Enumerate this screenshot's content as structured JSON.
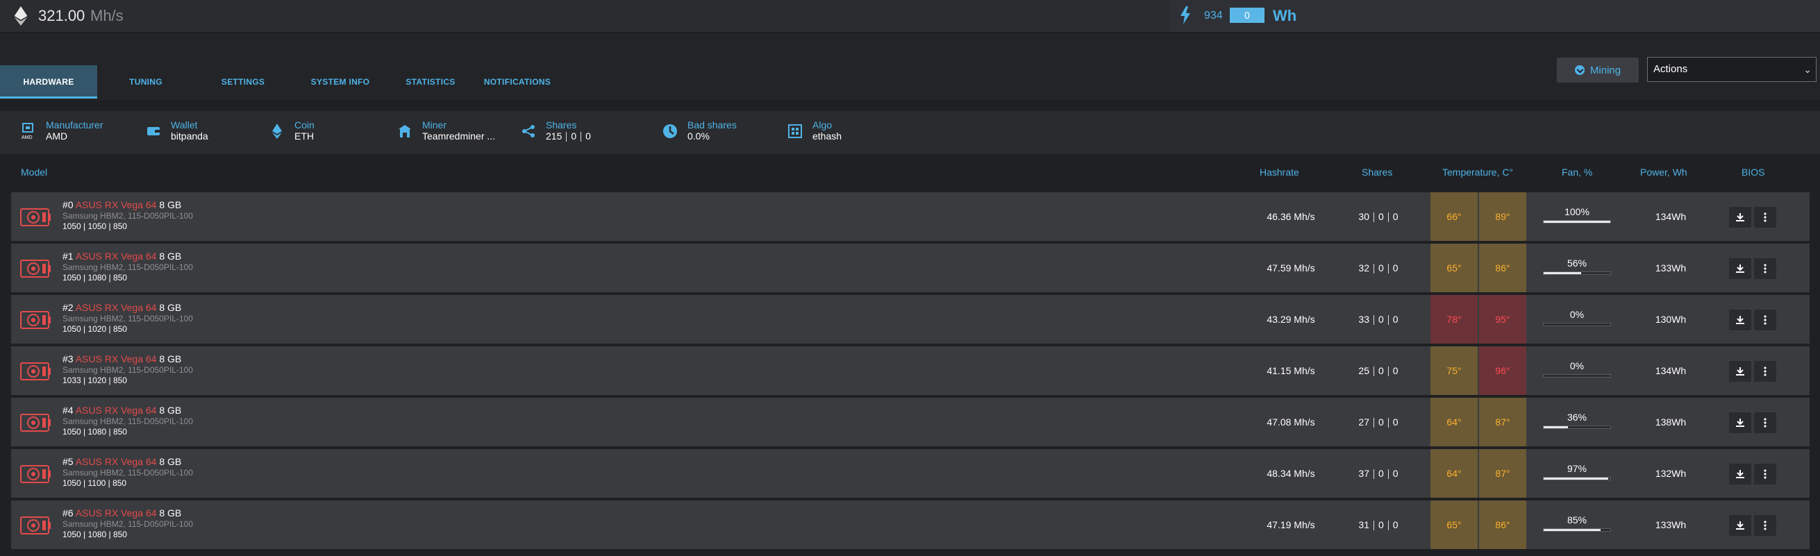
{
  "topbar": {
    "hashrate_value": "321.00",
    "hashrate_unit": "Mh/s",
    "power_value": "934",
    "power_box": "0",
    "power_unit": "Wh"
  },
  "tabs": [
    {
      "label": "HARDWARE",
      "active": true
    },
    {
      "label": "TUNING"
    },
    {
      "label": "SETTINGS"
    },
    {
      "label": "SYSTEM INFO"
    },
    {
      "label": "STATISTICS"
    },
    {
      "label": "NOTIFICATIONS"
    }
  ],
  "controls": {
    "mining_label": "Mining",
    "actions_label": "Actions"
  },
  "info": {
    "manufacturer": {
      "label": "Manufacturer",
      "value": "AMD",
      "icon_text": "AMD"
    },
    "wallet": {
      "label": "Wallet",
      "value": "bitpanda"
    },
    "coin": {
      "label": "Coin",
      "value": "ETH"
    },
    "miner": {
      "label": "Miner",
      "value": "Teamredminer ..."
    },
    "shares": {
      "label": "Shares",
      "a": "215",
      "b": "0",
      "c": "0"
    },
    "bad_shares": {
      "label": "Bad shares",
      "value": "0.0%"
    },
    "algo": {
      "label": "Algo",
      "value": "ethash"
    }
  },
  "headers": {
    "model": "Model",
    "hashrate": "Hashrate",
    "shares": "Shares",
    "temperature": "Temperature, C°",
    "fan": "Fan, %",
    "power": "Power, Wh",
    "bios": "BIOS"
  },
  "gpus": [
    {
      "index": "#0",
      "brand": "ASUS RX Vega 64",
      "size": "8 GB",
      "mem": "Samsung HBM2, 115-D050PIL-100",
      "clocks": "1050 | 1050 | 850",
      "hashrate": "46.36 Mh/s",
      "shares": [
        "30",
        "0",
        "0"
      ],
      "core_temp": "66°",
      "mem_temp": "89°",
      "core_level": "warm",
      "mem_level": "warm",
      "fan": "100%",
      "fan_pct": 100,
      "power": "134Wh"
    },
    {
      "index": "#1",
      "brand": "ASUS RX Vega 64",
      "size": "8 GB",
      "mem": "Samsung HBM2, 115-D050PIL-100",
      "clocks": "1050 | 1080 | 850",
      "hashrate": "47.59 Mh/s",
      "shares": [
        "32",
        "0",
        "0"
      ],
      "core_temp": "65°",
      "mem_temp": "86°",
      "core_level": "warm",
      "mem_level": "warm",
      "fan": "56%",
      "fan_pct": 56,
      "power": "133Wh"
    },
    {
      "index": "#2",
      "brand": "ASUS RX Vega 64",
      "size": "8 GB",
      "mem": "Samsung HBM2, 115-D050PIL-100",
      "clocks": "1050 | 1020 | 850",
      "hashrate": "43.29 Mh/s",
      "shares": [
        "33",
        "0",
        "0"
      ],
      "core_temp": "78°",
      "mem_temp": "95°",
      "core_level": "hot",
      "mem_level": "hot",
      "fan": "0%",
      "fan_pct": 0,
      "power": "130Wh"
    },
    {
      "index": "#3",
      "brand": "ASUS RX Vega 64",
      "size": "8 GB",
      "mem": "Samsung HBM2, 115-D050PIL-100",
      "clocks": "1033 | 1020 | 850",
      "hashrate": "41.15 Mh/s",
      "shares": [
        "25",
        "0",
        "0"
      ],
      "core_temp": "75°",
      "mem_temp": "96°",
      "core_level": "warm",
      "mem_level": "hot",
      "fan": "0%",
      "fan_pct": 0,
      "power": "134Wh"
    },
    {
      "index": "#4",
      "brand": "ASUS RX Vega 64",
      "size": "8 GB",
      "mem": "Samsung HBM2, 115-D050PIL-100",
      "clocks": "1050 | 1080 | 850",
      "hashrate": "47.08 Mh/s",
      "shares": [
        "27",
        "0",
        "0"
      ],
      "core_temp": "64°",
      "mem_temp": "87°",
      "core_level": "warm",
      "mem_level": "warm",
      "fan": "36%",
      "fan_pct": 36,
      "power": "138Wh"
    },
    {
      "index": "#5",
      "brand": "ASUS RX Vega 64",
      "size": "8 GB",
      "mem": "Samsung HBM2, 115-D050PIL-100",
      "clocks": "1050 | 1100 | 850",
      "hashrate": "48.34 Mh/s",
      "shares": [
        "37",
        "0",
        "0"
      ],
      "core_temp": "64°",
      "mem_temp": "87°",
      "core_level": "warm",
      "mem_level": "warm",
      "fan": "97%",
      "fan_pct": 97,
      "power": "132Wh"
    },
    {
      "index": "#6",
      "brand": "ASUS RX Vega 64",
      "size": "8 GB",
      "mem": "Samsung HBM2, 115-D050PIL-100",
      "clocks": "1050 | 1080 | 850",
      "hashrate": "47.19 Mh/s",
      "shares": [
        "31",
        "0",
        "0"
      ],
      "core_temp": "65°",
      "mem_temp": "86°",
      "core_level": "warm",
      "mem_level": "warm",
      "fan": "85%",
      "fan_pct": 85,
      "power": "133Wh"
    }
  ],
  "colors": {
    "accent": "#4fb3e8",
    "brand_red": "#e34b4b",
    "warm": "#ffb02e",
    "hot": "#ff4a55"
  }
}
